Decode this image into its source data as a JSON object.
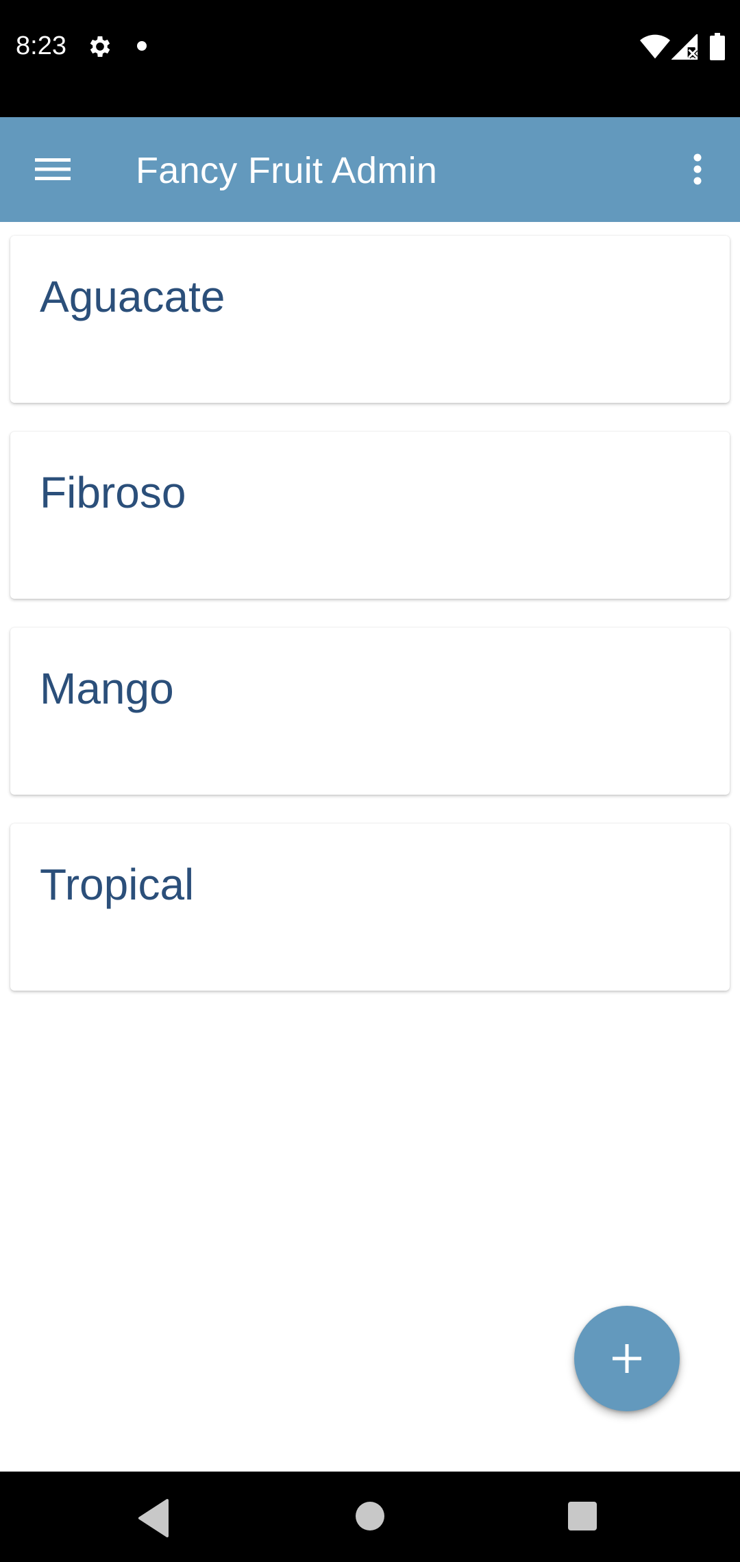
{
  "status_bar": {
    "time": "8:23",
    "icons": [
      "gear-icon",
      "notification-dot-icon",
      "wifi-icon",
      "signal-icon",
      "battery-icon"
    ]
  },
  "app_bar": {
    "title": "Fancy Fruit Admin",
    "menu_icon": "hamburger-menu-icon",
    "overflow_icon": "more-vert-icon",
    "background_color": "#6399bd"
  },
  "list": {
    "items": [
      {
        "label": "Aguacate"
      },
      {
        "label": "Fibroso"
      },
      {
        "label": "Mango"
      },
      {
        "label": "Tropical"
      }
    ],
    "text_color": "#2b4f7a"
  },
  "fab": {
    "icon": "plus-icon",
    "color": "#6399bd"
  },
  "nav_bar": {
    "icons": [
      "back-icon",
      "home-icon",
      "recents-icon"
    ]
  }
}
